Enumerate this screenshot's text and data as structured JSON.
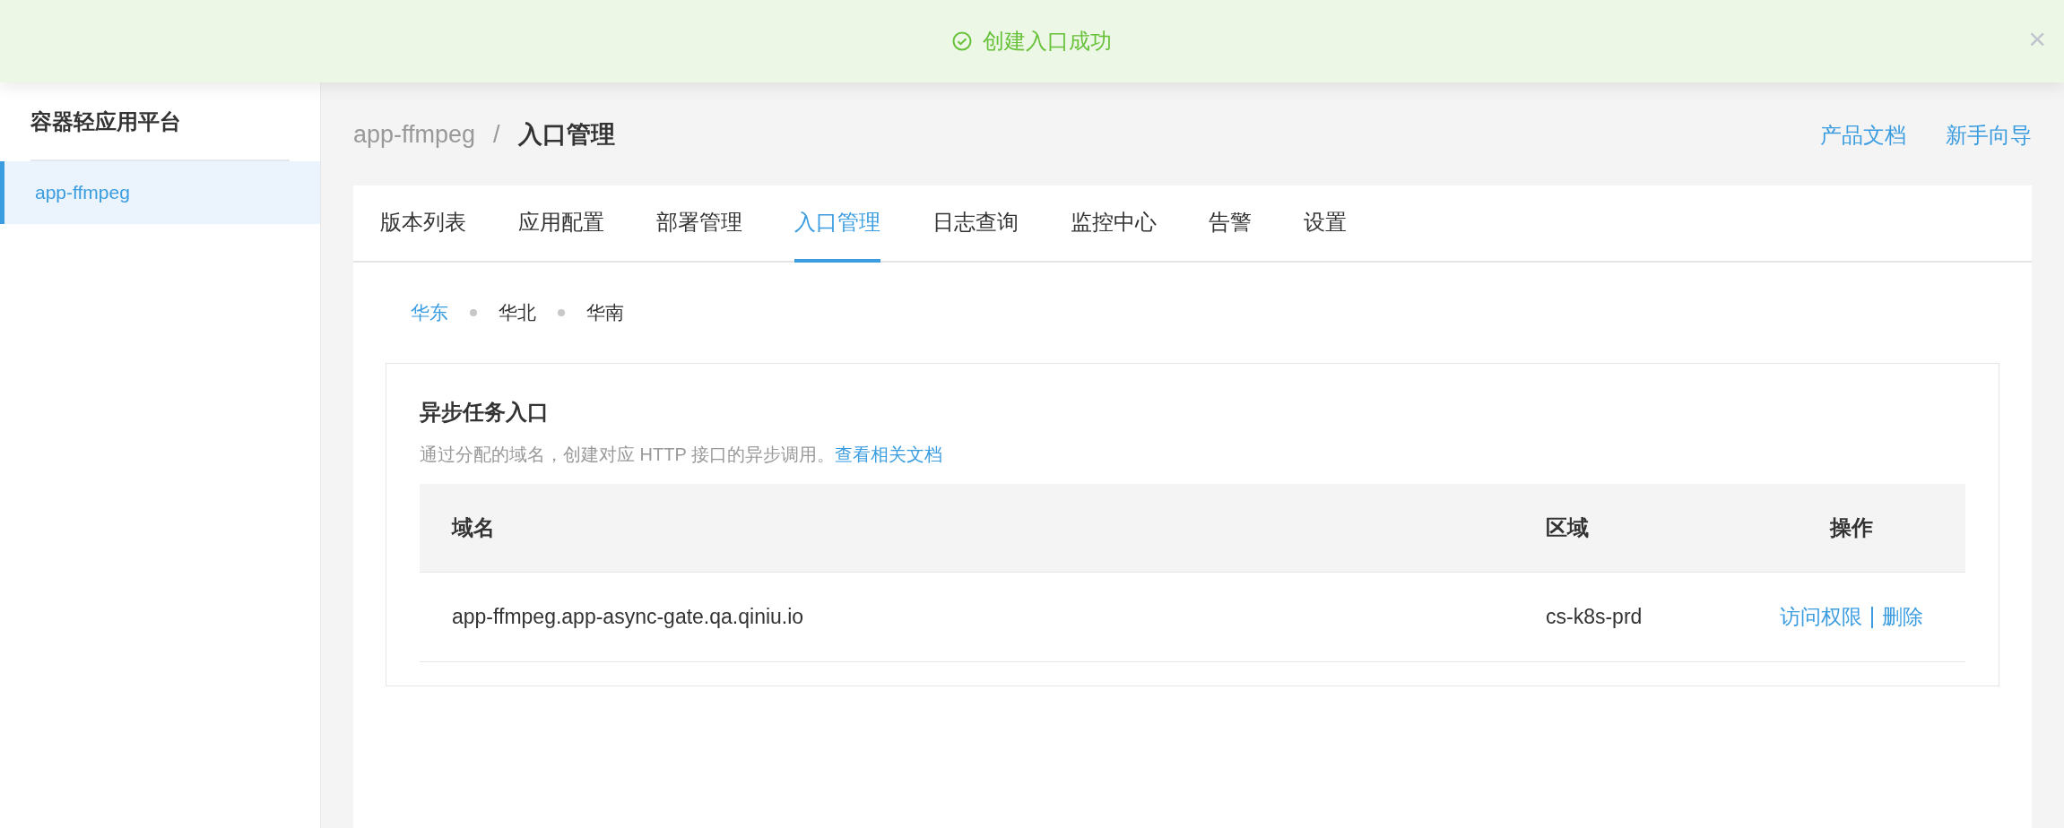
{
  "toast": {
    "message": "创建入口成功",
    "close": "×"
  },
  "sidebar": {
    "title": "容器轻应用平台",
    "items": [
      {
        "label": "app-ffmpeg",
        "selected": true
      }
    ]
  },
  "breadcrumb": [
    "app-ffmpeg",
    "/",
    "入口管理"
  ],
  "header_links": [
    "产品文档",
    "新手向导"
  ],
  "tabs": [
    {
      "label": "版本列表",
      "selected": false
    },
    {
      "label": "应用配置",
      "selected": false
    },
    {
      "label": "部署管理",
      "selected": false
    },
    {
      "label": "入口管理",
      "selected": true
    },
    {
      "label": "日志查询",
      "selected": false
    },
    {
      "label": "监控中心",
      "selected": false
    },
    {
      "label": "告警",
      "selected": false
    },
    {
      "label": "设置",
      "selected": false
    }
  ],
  "regions": [
    {
      "label": "华东",
      "selected": true
    },
    {
      "label": "华北",
      "selected": false
    },
    {
      "label": "华南",
      "selected": false
    }
  ],
  "panel": {
    "title": "异步任务入口",
    "description": "通过分配的域名，创建对应 HTTP 接口的异步调用。",
    "doc_link": "查看相关文档",
    "table": {
      "columns": [
        "域名",
        "区域",
        "操作"
      ],
      "rows": [
        {
          "domain": "app-ffmpeg.app-async-gate.qa.qiniu.io",
          "region": "cs-k8s-prd",
          "actions": [
            "访问权限",
            "删除"
          ]
        }
      ]
    }
  }
}
